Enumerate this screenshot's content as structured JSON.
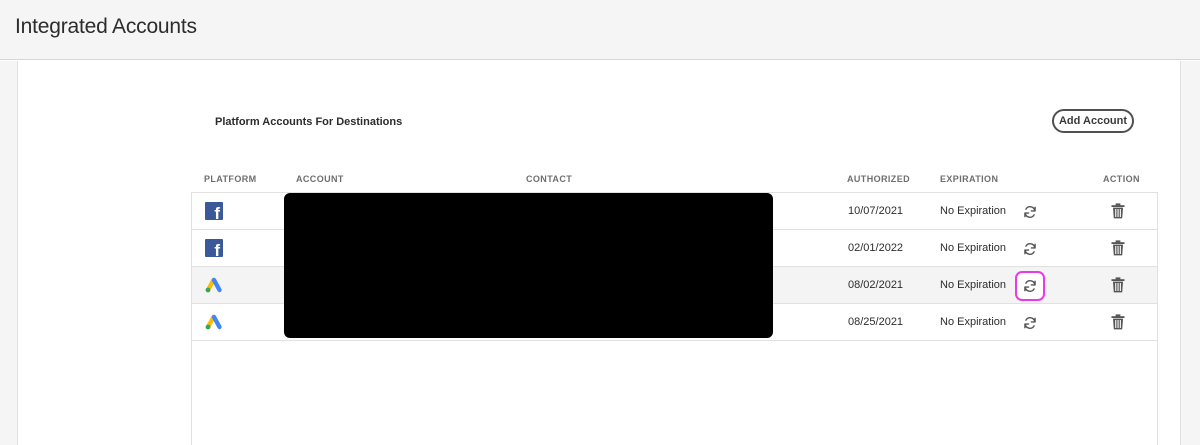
{
  "page": {
    "title": "Integrated Accounts"
  },
  "section": {
    "title": "Platform Accounts For Destinations",
    "add_button_label": "Add Account"
  },
  "table": {
    "columns": {
      "platform": "PLATFORM",
      "account": "ACCOUNT",
      "contact": "CONTACT",
      "authorized": "AUTHORIZED",
      "expiration": "EXPIRATION",
      "action": "ACTION"
    },
    "rows": [
      {
        "platform": "facebook",
        "platform_icon": "facebook-icon",
        "authorized": "10/07/2021",
        "expiration": "No Expiration",
        "highlighted": false
      },
      {
        "platform": "facebook",
        "platform_icon": "facebook-icon",
        "authorized": "02/01/2022",
        "expiration": "No Expiration",
        "highlighted": false
      },
      {
        "platform": "google-ads",
        "platform_icon": "google-ads-icon",
        "authorized": "08/02/2021",
        "expiration": "No Expiration",
        "highlighted": true
      },
      {
        "platform": "google-ads",
        "platform_icon": "google-ads-icon",
        "authorized": "08/25/2021",
        "expiration": "No Expiration",
        "highlighted": false
      }
    ]
  },
  "colors": {
    "focus_ring": "#e83be8",
    "facebook_blue": "#3b5998",
    "google_blue": "#4285f4",
    "google_yellow": "#fbbc04",
    "google_green": "#34a853",
    "redaction": "#000000"
  }
}
